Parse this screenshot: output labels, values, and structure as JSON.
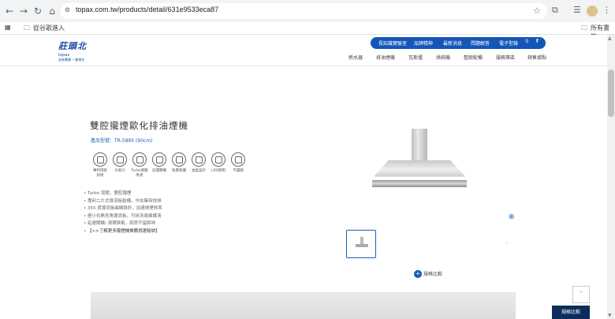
{
  "browser": {
    "url": "topax.com.tw/products/detail/631e9533eca87",
    "bookmarks_label": "從谷歌進入",
    "all_bookmarks_label": "所有書籤"
  },
  "header": {
    "logo_text": "莊頭北",
    "logo_sub": "topax",
    "logo_tag": "因為專業 一路領先",
    "top_links": [
      "長知識實驗室",
      "品牌精神",
      "最新消息",
      "問題解答",
      "電子型錄"
    ],
    "main_nav": [
      "熱水器",
      "排油煙機",
      "瓦斯爐",
      "烘碗機",
      "整廚配備",
      "服務專區",
      "銷售據點"
    ]
  },
  "product": {
    "title": "雙腔攏煙歐化排油煙機",
    "model": "產品型號：TR-5895 (90cm)",
    "features": [
      "專利環吸技術",
      "大吸力",
      "Turbo增壓馬達",
      "延遲關機",
      "負壓保護",
      "油盒設計",
      "LED照明",
      "不鏽鋼"
    ],
    "bullets": [
      "Turbo 增壓，雙腔攏煙",
      "專利二片式導流板結構，中央集吸快排",
      "355 度導流板曲線設計，加速排煙效率",
      "極小化無死角導流板，可拆洗易維護清",
      "延遲關機/ 渦環換氣，廚房不留餘味",
      "【>>了解更多攏煙機推薦挑選秘訣】"
    ],
    "compare_label": "規格比較",
    "spec_button": "規格比較"
  },
  "colors": {
    "brand_blue": "#1456b8",
    "dark_navy": "#0c2d5c"
  }
}
